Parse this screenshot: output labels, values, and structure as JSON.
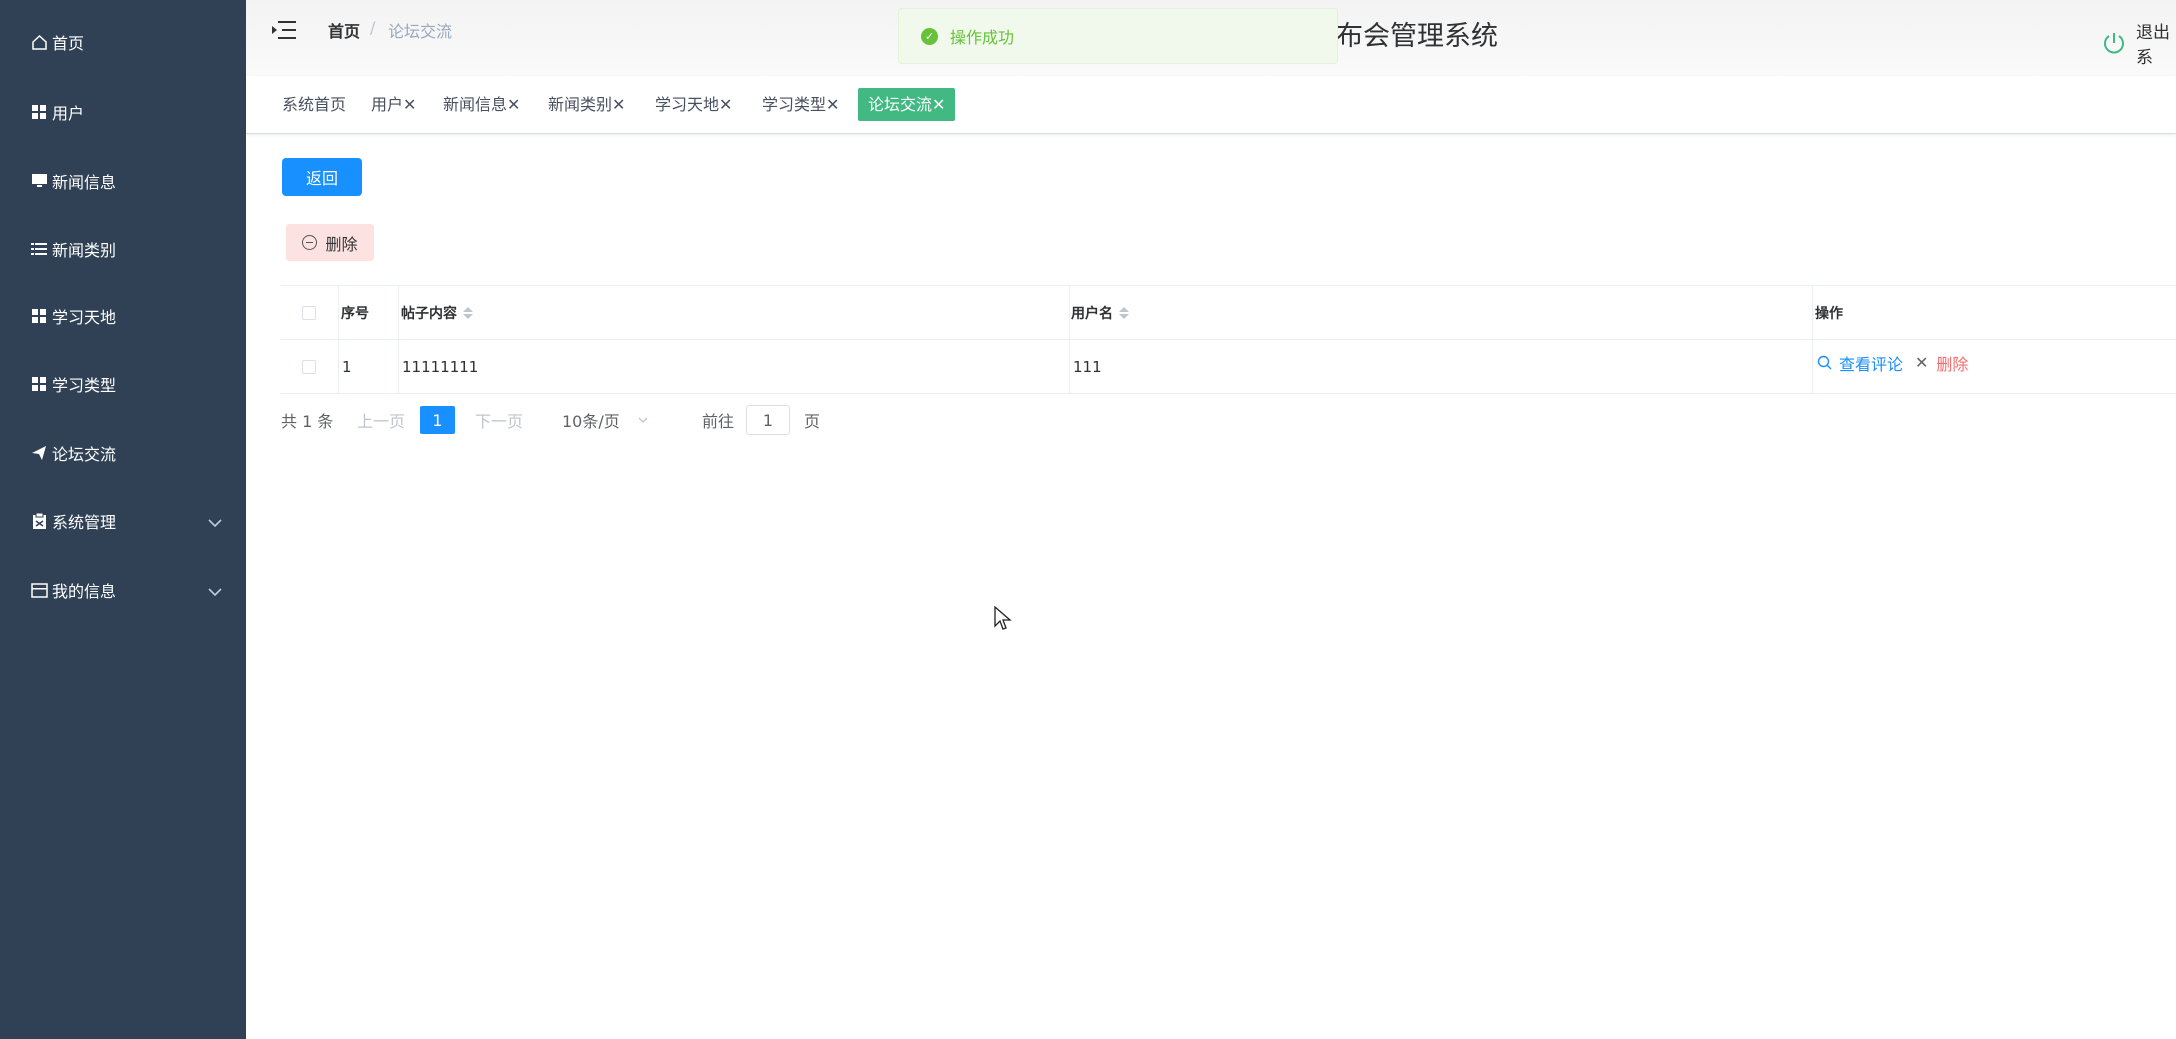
{
  "sidebar": {
    "items": [
      {
        "label": "首页",
        "icon": "home-icon"
      },
      {
        "label": "用户",
        "icon": "grid-icon"
      },
      {
        "label": "新闻信息",
        "icon": "monitor-icon"
      },
      {
        "label": "新闻类别",
        "icon": "list-icon"
      },
      {
        "label": "学习天地",
        "icon": "grid-icon"
      },
      {
        "label": "学习类型",
        "icon": "grid-icon"
      },
      {
        "label": "论坛交流",
        "icon": "send-icon"
      },
      {
        "label": "系统管理",
        "icon": "clipboard-icon"
      },
      {
        "label": "我的信息",
        "icon": "card-icon"
      }
    ]
  },
  "header": {
    "breadcrumb_home": "首页",
    "breadcrumb_sep": "/",
    "breadcrumb_current": "论坛交流",
    "system_title": "布会管理系统",
    "logout_label": "退出系"
  },
  "toast": {
    "message": "操作成功",
    "color": "#67c23a"
  },
  "tags": [
    {
      "label": "系统首页",
      "closable": false
    },
    {
      "label": "用户",
      "closable": true
    },
    {
      "label": "新闻信息",
      "closable": true
    },
    {
      "label": "新闻类别",
      "closable": true
    },
    {
      "label": "学习天地",
      "closable": true
    },
    {
      "label": "学习类型",
      "closable": true
    },
    {
      "label": "论坛交流",
      "closable": true,
      "active": true
    }
  ],
  "actions": {
    "back_label": "返回",
    "delete_label": "删除"
  },
  "table": {
    "columns": [
      "序号",
      "帖子内容",
      "用户名",
      "操作"
    ],
    "rows": [
      {
        "index": "1",
        "content": "11111111",
        "username": "111",
        "view_label": "查看评论",
        "delete_label": "删除"
      }
    ]
  },
  "pagination": {
    "total_label": "共 1 条",
    "prev_label": "上一页",
    "current_page": "1",
    "next_label": "下一页",
    "page_size": "10条/页",
    "goto_label": "前往",
    "goto_value": "1",
    "page_suffix": "页"
  },
  "colors": {
    "sidebar_bg": "#304156",
    "primary": "#1890ff",
    "active_tag": "#42b983",
    "danger": "#f56c6c"
  }
}
